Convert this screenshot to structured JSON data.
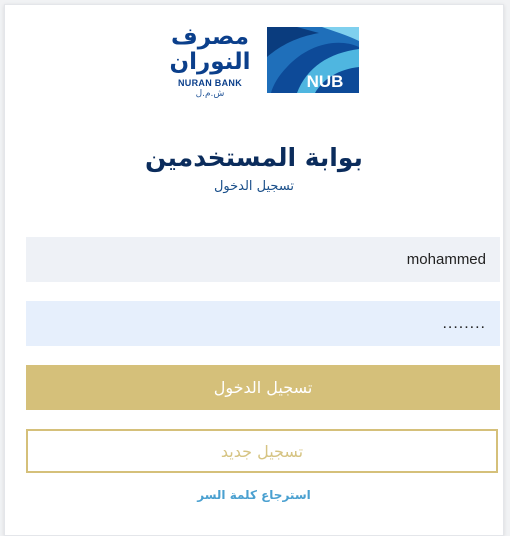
{
  "logo": {
    "arabic_line1": "مصرف",
    "arabic_line2": "النوران",
    "english_name": "NURAN BANK",
    "legal_suffix": "ش.م.ل",
    "mark_text": "NUB",
    "icon": "nub-logo-icon"
  },
  "heading": {
    "title": "بوابة المستخدمين",
    "subtitle": "تسجيل الدخول"
  },
  "form": {
    "username_value": "mohammed",
    "password_value": "........"
  },
  "buttons": {
    "login_label": "تسجيل الدخول",
    "register_label": "تسجيل جديد"
  },
  "links": {
    "forgot_password": "استرجاع كلمة السر"
  },
  "colors": {
    "gold": "#d5c07a",
    "navy": "#0b2c5c",
    "link_blue": "#4aa0d0",
    "logo_dark_blue": "#0b3f8b",
    "logo_light_blue": "#4fb6e0"
  }
}
